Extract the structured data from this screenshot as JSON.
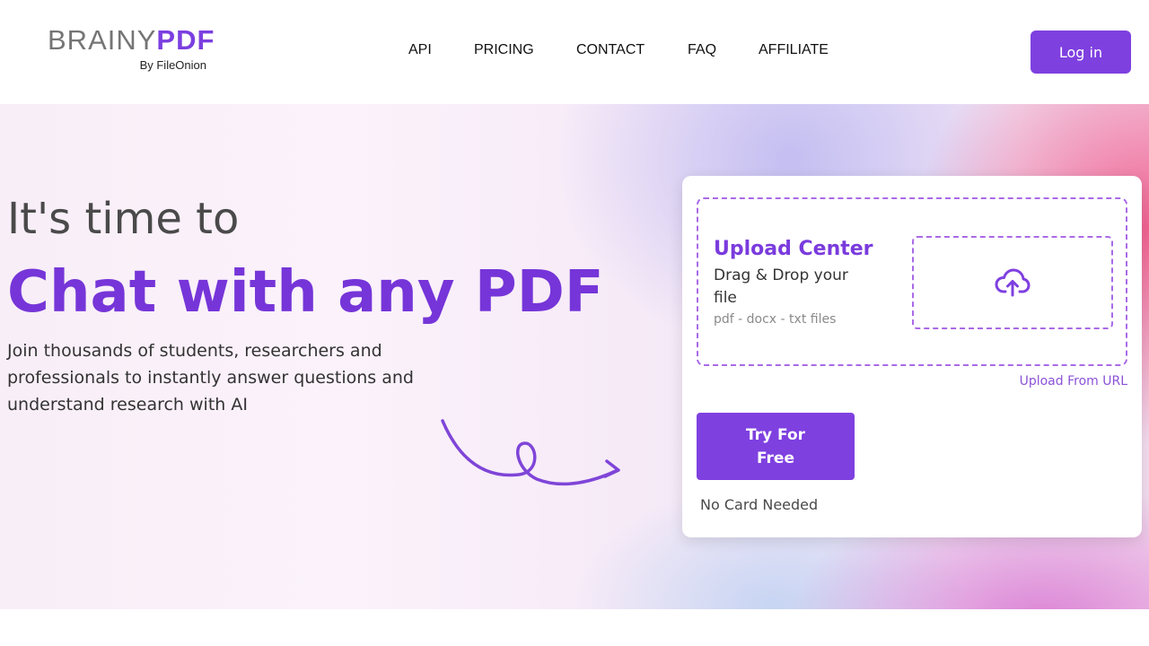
{
  "header": {
    "logo": {
      "brand_first": "BRAINY",
      "brand_second": "PDF",
      "byline": "By FileOnion"
    },
    "nav": [
      {
        "label": "API"
      },
      {
        "label": "PRICING"
      },
      {
        "label": "CONTACT"
      },
      {
        "label": "FAQ"
      },
      {
        "label": "AFFILIATE"
      }
    ],
    "login_label": "Log in"
  },
  "hero": {
    "pre_title": "It's time to",
    "title": "Chat with any PDF",
    "description": "Join thousands of students, researchers and professionals to instantly answer questions and understand research with AI",
    "arrow_icon": "curly-arrow-icon"
  },
  "upload_card": {
    "title": "Upload Center",
    "description": "Drag & Drop your file",
    "file_types": "pdf - docx - txt files",
    "upload_icon": "cloud-upload-icon",
    "upload_url_label": "Upload From URL",
    "cta_label": "Try For Free",
    "cta_note": "No Card Needed"
  },
  "colors": {
    "brand_purple": "#7f40e0",
    "title_purple": "#7635d8",
    "logo_gray": "#757575"
  }
}
